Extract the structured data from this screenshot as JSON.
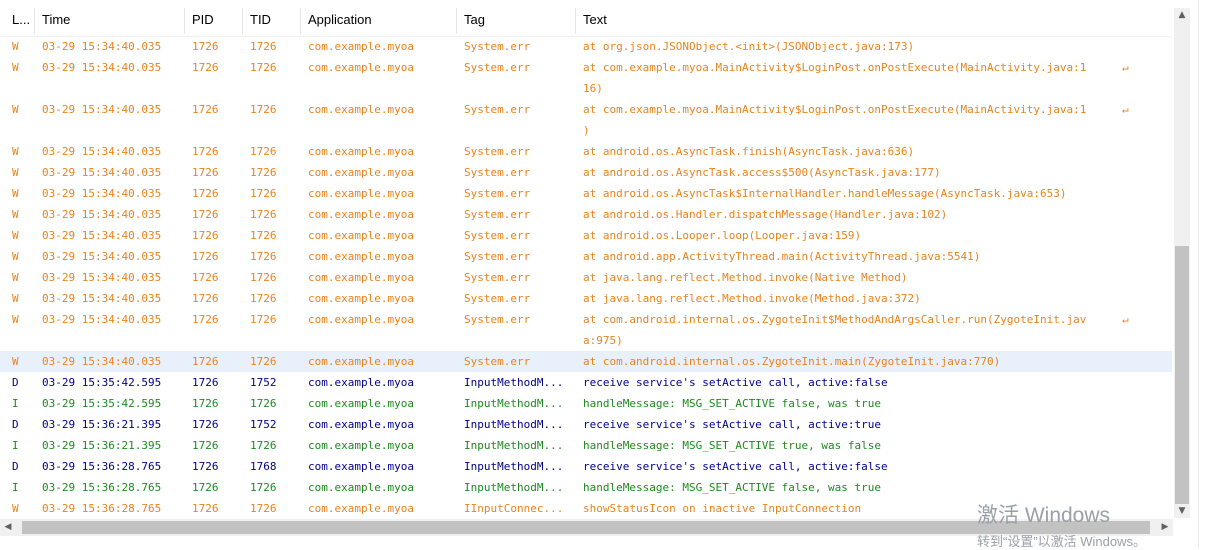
{
  "columns": {
    "level": "L...",
    "time": "Time",
    "pid": "PID",
    "tid": "TID",
    "application": "Application",
    "tag": "Tag",
    "text": "Text"
  },
  "colors": {
    "W": "#e8831e",
    "D": "#00008b",
    "I": "#1d8a1d",
    "selected_bg": "#e8f1fb"
  },
  "rows": [
    {
      "level": "W",
      "time": "03-29 15:34:40.035",
      "pid": "1726",
      "tid": "1726",
      "app": "com.example.myoa",
      "tag": "System.err",
      "text": "at org.json.JSONObject.<init>(JSONObject.java:173)",
      "wrap": false
    },
    {
      "level": "W",
      "time": "03-29 15:34:40.035",
      "pid": "1726",
      "tid": "1726",
      "app": "com.example.myoa",
      "tag": "System.err",
      "text": "at com.example.myoa.MainActivity$LoginPost.onPostExecute(MainActivity.java:1\n16)",
      "wrap": true
    },
    {
      "level": "W",
      "time": "03-29 15:34:40.035",
      "pid": "1726",
      "tid": "1726",
      "app": "com.example.myoa",
      "tag": "System.err",
      "text": "at com.example.myoa.MainActivity$LoginPost.onPostExecute(MainActivity.java:1\n)",
      "wrap": true
    },
    {
      "level": "W",
      "time": "03-29 15:34:40.035",
      "pid": "1726",
      "tid": "1726",
      "app": "com.example.myoa",
      "tag": "System.err",
      "text": "at android.os.AsyncTask.finish(AsyncTask.java:636)",
      "wrap": false
    },
    {
      "level": "W",
      "time": "03-29 15:34:40.035",
      "pid": "1726",
      "tid": "1726",
      "app": "com.example.myoa",
      "tag": "System.err",
      "text": "at android.os.AsyncTask.access$500(AsyncTask.java:177)",
      "wrap": false
    },
    {
      "level": "W",
      "time": "03-29 15:34:40.035",
      "pid": "1726",
      "tid": "1726",
      "app": "com.example.myoa",
      "tag": "System.err",
      "text": "at android.os.AsyncTask$InternalHandler.handleMessage(AsyncTask.java:653)",
      "wrap": false
    },
    {
      "level": "W",
      "time": "03-29 15:34:40.035",
      "pid": "1726",
      "tid": "1726",
      "app": "com.example.myoa",
      "tag": "System.err",
      "text": "at android.os.Handler.dispatchMessage(Handler.java:102)",
      "wrap": false
    },
    {
      "level": "W",
      "time": "03-29 15:34:40.035",
      "pid": "1726",
      "tid": "1726",
      "app": "com.example.myoa",
      "tag": "System.err",
      "text": "at android.os.Looper.loop(Looper.java:159)",
      "wrap": false
    },
    {
      "level": "W",
      "time": "03-29 15:34:40.035",
      "pid": "1726",
      "tid": "1726",
      "app": "com.example.myoa",
      "tag": "System.err",
      "text": "at android.app.ActivityThread.main(ActivityThread.java:5541)",
      "wrap": false
    },
    {
      "level": "W",
      "time": "03-29 15:34:40.035",
      "pid": "1726",
      "tid": "1726",
      "app": "com.example.myoa",
      "tag": "System.err",
      "text": "at java.lang.reflect.Method.invoke(Native Method)",
      "wrap": false
    },
    {
      "level": "W",
      "time": "03-29 15:34:40.035",
      "pid": "1726",
      "tid": "1726",
      "app": "com.example.myoa",
      "tag": "System.err",
      "text": "at java.lang.reflect.Method.invoke(Method.java:372)",
      "wrap": false
    },
    {
      "level": "W",
      "time": "03-29 15:34:40.035",
      "pid": "1726",
      "tid": "1726",
      "app": "com.example.myoa",
      "tag": "System.err",
      "text": "at com.android.internal.os.ZygoteInit$MethodAndArgsCaller.run(ZygoteInit.jav\na:975)",
      "wrap": true
    },
    {
      "level": "W",
      "time": "03-29 15:34:40.035",
      "pid": "1726",
      "tid": "1726",
      "app": "com.example.myoa",
      "tag": "System.err",
      "text": "at com.android.internal.os.ZygoteInit.main(ZygoteInit.java:770)",
      "wrap": false,
      "selected": true
    },
    {
      "level": "D",
      "time": "03-29 15:35:42.595",
      "pid": "1726",
      "tid": "1752",
      "app": "com.example.myoa",
      "tag": "InputMethodM...",
      "text": "receive service's setActive call, active:false",
      "wrap": false
    },
    {
      "level": "I",
      "time": "03-29 15:35:42.595",
      "pid": "1726",
      "tid": "1726",
      "app": "com.example.myoa",
      "tag": "InputMethodM...",
      "text": "handleMessage: MSG_SET_ACTIVE false, was true",
      "wrap": false
    },
    {
      "level": "D",
      "time": "03-29 15:36:21.395",
      "pid": "1726",
      "tid": "1752",
      "app": "com.example.myoa",
      "tag": "InputMethodM...",
      "text": "receive service's setActive call, active:true",
      "wrap": false
    },
    {
      "level": "I",
      "time": "03-29 15:36:21.395",
      "pid": "1726",
      "tid": "1726",
      "app": "com.example.myoa",
      "tag": "InputMethodM...",
      "text": "handleMessage: MSG_SET_ACTIVE true, was false",
      "wrap": false
    },
    {
      "level": "D",
      "time": "03-29 15:36:28.765",
      "pid": "1726",
      "tid": "1768",
      "app": "com.example.myoa",
      "tag": "InputMethodM...",
      "text": "receive service's setActive call, active:false",
      "wrap": false
    },
    {
      "level": "I",
      "time": "03-29 15:36:28.765",
      "pid": "1726",
      "tid": "1726",
      "app": "com.example.myoa",
      "tag": "InputMethodM...",
      "text": "handleMessage: MSG_SET_ACTIVE false, was true",
      "wrap": false
    },
    {
      "level": "W",
      "time": "03-29 15:36:28.765",
      "pid": "1726",
      "tid": "1726",
      "app": "com.example.myoa",
      "tag": "IInputConnec...",
      "text": "showStatusIcon on inactive InputConnection",
      "wrap": false
    }
  ],
  "watermark": {
    "line1": "激活 Windows",
    "line2": "转到“设置”以激活 Windows。"
  }
}
